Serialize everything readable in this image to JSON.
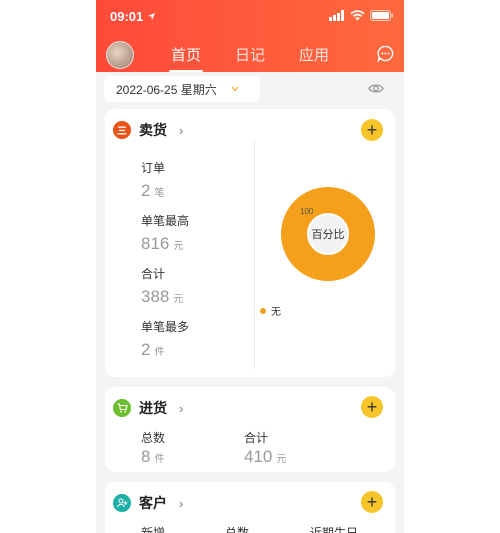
{
  "status": {
    "time": "09:01"
  },
  "header": {
    "tabs": [
      {
        "label": "首页"
      },
      {
        "label": "日记"
      },
      {
        "label": "应用"
      }
    ]
  },
  "datebar": {
    "date": "2022-06-25 星期六"
  },
  "sell": {
    "title": "卖货",
    "icon_text": "三",
    "icon_color": "#e8531a",
    "items": [
      {
        "label": "订单",
        "value": "2",
        "unit": "笔"
      },
      {
        "label": "单笔最高",
        "value": "816",
        "unit": "元"
      },
      {
        "label": "合计",
        "value": "388",
        "unit": "元"
      },
      {
        "label": "单笔最多",
        "value": "2",
        "unit": "件"
      }
    ],
    "donut": {
      "center_label": "百分比",
      "slice_label": "100",
      "legend": "无",
      "color": "#f5a01a",
      "value": 100
    }
  },
  "purchase": {
    "title": "进货",
    "icon_color": "#6bbf2e",
    "items": [
      {
        "label": "总数",
        "value": "8",
        "unit": "件"
      },
      {
        "label": "合计",
        "value": "410",
        "unit": "元"
      }
    ]
  },
  "customer": {
    "title": "客户",
    "icon_color": "#1fb0a8",
    "items": [
      {
        "label": "新增"
      },
      {
        "label": "总数"
      },
      {
        "label": "近期生日"
      }
    ]
  }
}
